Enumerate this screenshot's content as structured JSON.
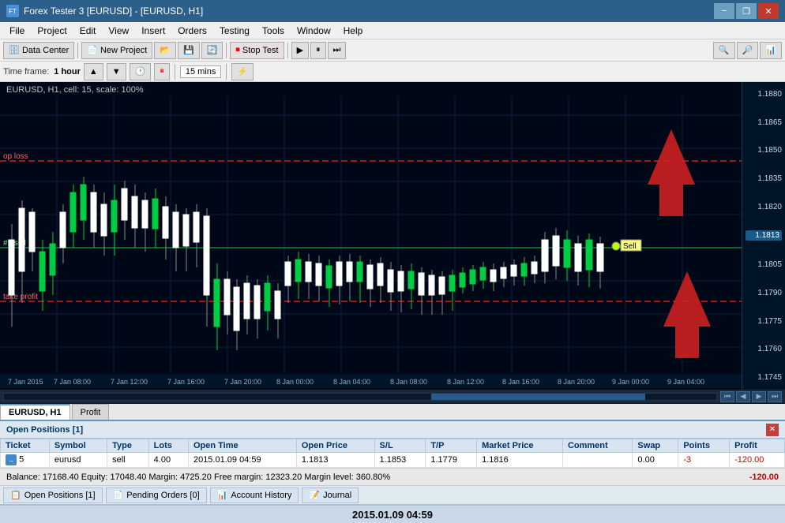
{
  "title_bar": {
    "title": "Forex Tester 3  [EURUSD] - [EURUSD, H1]",
    "min_btn": "−",
    "restore_btn": "❐",
    "close_btn": "✕"
  },
  "menu": {
    "items": [
      "File",
      "Project",
      "Edit",
      "View",
      "Insert",
      "Orders",
      "Testing",
      "Tools",
      "Window",
      "Help"
    ]
  },
  "toolbar1": {
    "data_center": "Data Center",
    "new_project": "New Project",
    "stop_test": "Stop Test",
    "separator": "|"
  },
  "toolbar2": {
    "timeframe_label": "Time frame:",
    "timeframe_value": "1 hour",
    "speed_label": "15 mins"
  },
  "chart": {
    "header": "EURUSD, H1, cell: 15, scale: 100%",
    "stop_loss_label": "op loss",
    "sell_label": "#5 sell",
    "take_profit_label": "take profit",
    "sell_marker_label": "Sell",
    "price_levels": [
      "1.1880",
      "1.1865",
      "1.1850",
      "1.1835",
      "1.1820",
      "1.1813",
      "1.1805",
      "1.1790",
      "1.1775",
      "1.1760",
      "1.1745"
    ],
    "time_labels": [
      "7 Jan 2015",
      "7 Jan 08:00",
      "7 Jan 12:00",
      "7 Jan 16:00",
      "7 Jan 20:00",
      "8 Jan 00:00",
      "8 Jan 04:00",
      "8 Jan 08:00",
      "8 Jan 12:00",
      "8 Jan 16:00",
      "8 Jan 20:00",
      "9 Jan 00:00",
      "9 Jan 04:00"
    ],
    "current_price": "1.1813"
  },
  "scrollbar": {
    "left_arrow": "◀",
    "right_arrow": "▶",
    "first": "⏮",
    "prev": "◀",
    "next": "▶",
    "last": "⏭"
  },
  "chart_tabs": {
    "tabs": [
      "EURUSD, H1",
      "Profit"
    ]
  },
  "positions_panel": {
    "title": "Open Positions [1]",
    "close_btn": "✕",
    "columns": [
      "Ticket",
      "Symbol",
      "Type",
      "Lots",
      "Open Time",
      "Open Price",
      "S/L",
      "T/P",
      "Market Price",
      "Comment",
      "Swap",
      "Points",
      "Profit"
    ],
    "rows": [
      {
        "ticket": "5",
        "symbol": "eurusd",
        "type": "sell",
        "lots": "4.00",
        "open_time": "2015.01.09 04:59",
        "open_price": "1.1813",
        "sl": "1.1853",
        "tp": "1.1779",
        "market_price": "1.1816",
        "comment": "",
        "swap": "0.00",
        "points": "-3",
        "profit": "-120.00"
      }
    ]
  },
  "balance_bar": {
    "text": "Balance: 17168.40  Equity: 17048.40  Margin: 4725.20  Free margin: 12323.20  Margin level: 360.80%",
    "profit": "-120.00"
  },
  "bottom_tabs": {
    "tabs": [
      "Open Positions [1]",
      "Pending Orders [0]",
      "Account History",
      "Journal"
    ]
  },
  "datetime": {
    "value": "2015.01.09 04:59"
  }
}
